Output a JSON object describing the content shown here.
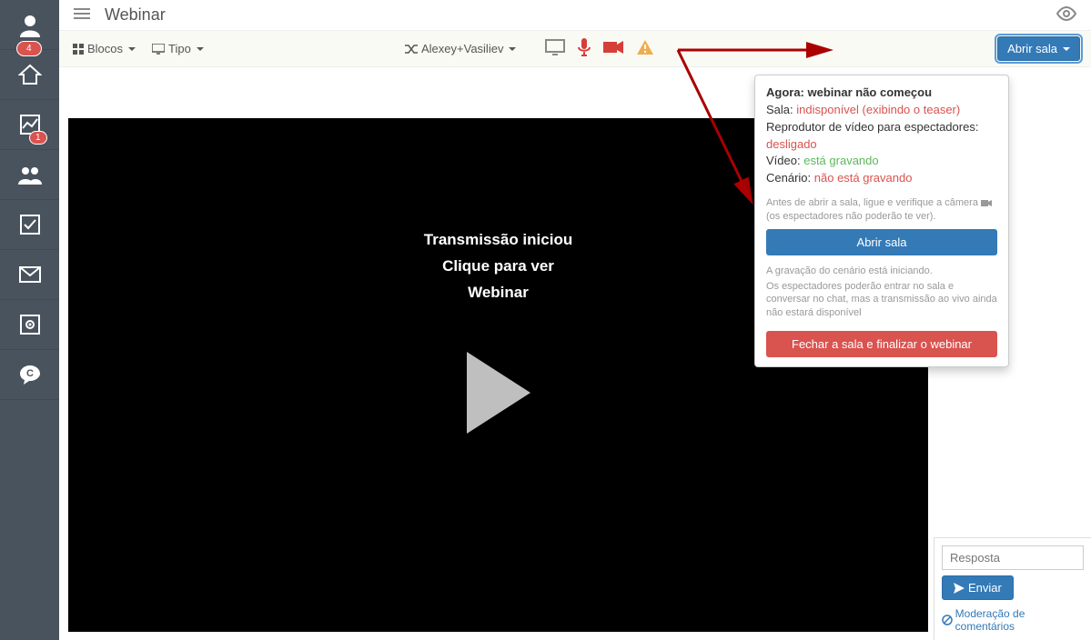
{
  "sidebar": {
    "badge1": "4",
    "badge2": "1"
  },
  "header": {
    "title": "Webinar"
  },
  "toolbar": {
    "blocos": "Blocos",
    "tipo": "Tipo",
    "presenter": "Alexey+Vasiliev",
    "open_room": "Abrir sala"
  },
  "video": {
    "line1": "Transmissão iniciou",
    "line2": "Clique para ver",
    "line3": "Webinar"
  },
  "popover": {
    "now_label": "Agora:",
    "now_value": "webinar não começou",
    "sala_label": "Sala:",
    "sala_value": "indisponível (exibindo o teaser)",
    "reproducer": "Reprodutor de vídeo para espectadores:",
    "reproducer_value": "desligado",
    "video_label": "Vídeo:",
    "video_value": "está gravando",
    "cenario_label": "Cenário:",
    "cenario_value": "não está gravando",
    "note1a": "Antes de abrir a sala, ligue e verifique a câmera",
    "note1b": "(os espectadores não poderão te ver).",
    "open_btn": "Abrir sala",
    "note2": "A gravação do cenário está iniciando.",
    "note3": "Os espectadores poderão entrar no sala e conversar no chat, mas a transmissão ao vivo ainda não estará disponível",
    "close_btn": "Fechar a sala e finalizar o webinar"
  },
  "chat": {
    "placeholder": "Resposta",
    "send": "Enviar",
    "moderation": "Moderação de comentários"
  }
}
